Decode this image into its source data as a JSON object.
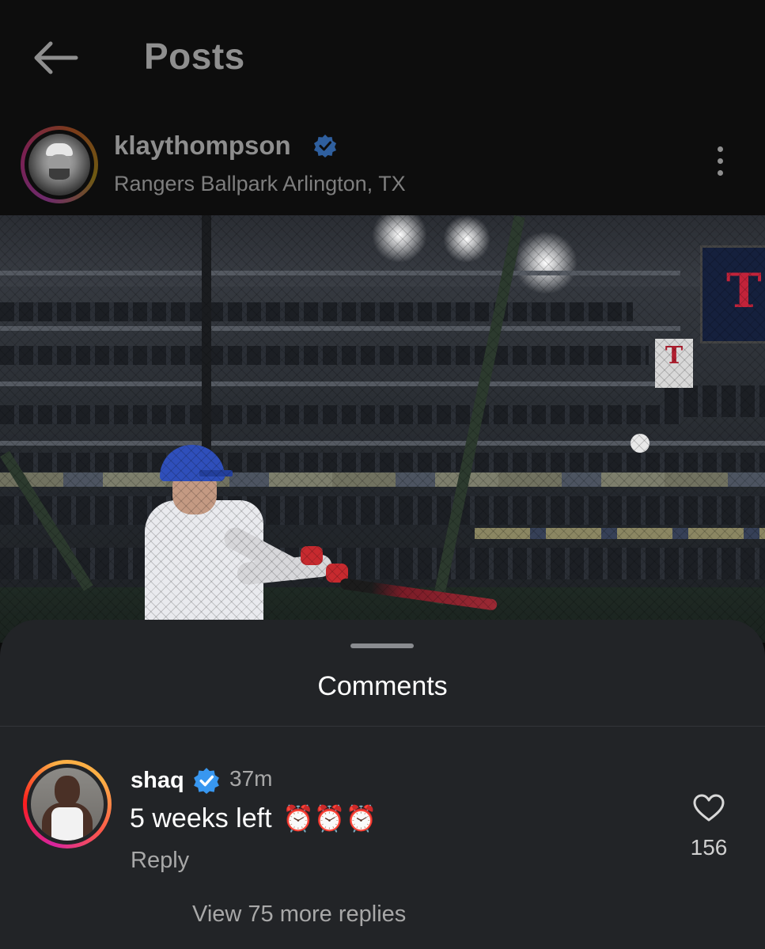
{
  "header": {
    "title": "Posts",
    "back_icon": "arrow-left-icon"
  },
  "post": {
    "username": "klaythompson",
    "verified": true,
    "location": "Rangers Ballpark Arlington, TX",
    "menu_icon": "more-vertical-icon"
  },
  "comments": {
    "title": "Comments",
    "items": [
      {
        "username": "shaq",
        "verified": true,
        "time": "37m",
        "text": "5 weeks left",
        "emoji": "⏰⏰⏰",
        "reply_label": "Reply",
        "likes": "156"
      }
    ],
    "view_more_label": "View 75 more replies"
  },
  "colors": {
    "verified_blue": "#3897f0",
    "sheet_bg": "#222427",
    "app_bg": "#0b0b0b"
  }
}
